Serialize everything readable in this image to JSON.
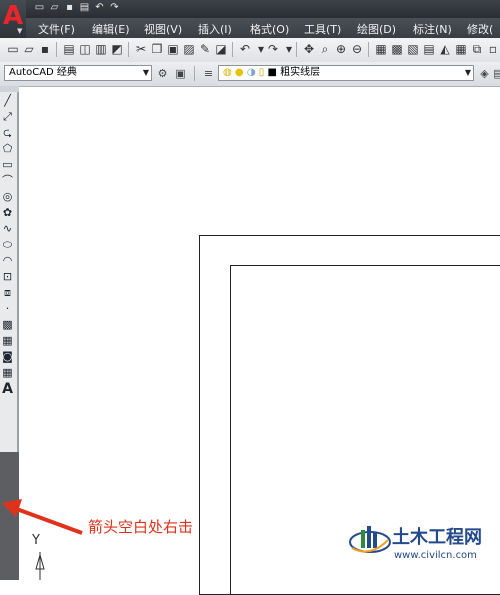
{
  "titlebar": {
    "app_letter": "A",
    "qat_icons": [
      "new-icon",
      "open-icon",
      "save-icon",
      "print-icon",
      "undo-icon",
      "redo-icon"
    ]
  },
  "menu": {
    "file": "文件(F)",
    "edit": "编辑(E)",
    "view": "视图(V)",
    "insert": "插入(I)",
    "format": "格式(O)",
    "tools": "工具(T)",
    "draw": "绘图(D)",
    "dimension": "标注(N)",
    "modify": "修改("
  },
  "toolbar2": {
    "workspace": "AutoCAD 经典",
    "layer": "粗实线层"
  },
  "left_tools": [
    "line-icon",
    "construction-line-icon",
    "polyline-icon",
    "polygon-icon",
    "rectangle-icon",
    "arc-icon",
    "circle-icon",
    "revcloud-icon",
    "spline-icon",
    "ellipse-icon",
    "ellipse-arc-icon",
    "insert-block-icon",
    "make-block-icon",
    "point-icon",
    "hatch-icon",
    "gradient-icon",
    "region-icon",
    "table-icon",
    "text-icon"
  ],
  "annotation": "箭头空白处右击",
  "ucs": {
    "y_label": "Y"
  },
  "watermark": {
    "name": "土木工程网",
    "url": "www.civilcn.com"
  },
  "colors": {
    "annotation_red": "#e0321b",
    "app_red": "#e8262b",
    "watermark_blue": "#234a8c"
  }
}
